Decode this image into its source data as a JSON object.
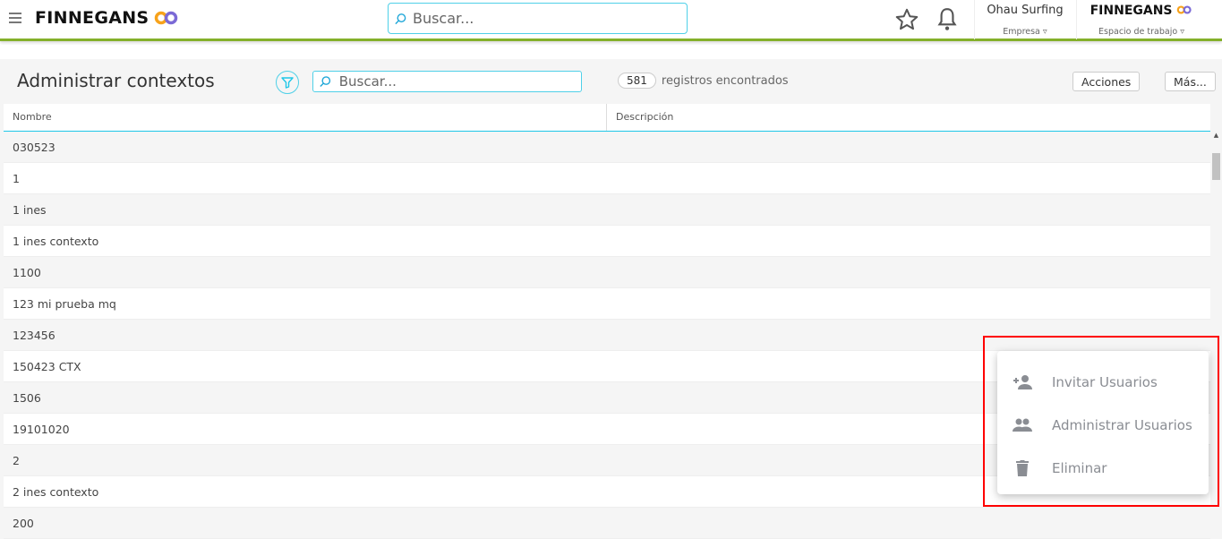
{
  "topbar": {
    "brand": "FINNEGANS",
    "search_placeholder": "Buscar...",
    "company": "Ohau Surfing",
    "company_label": "Empresa",
    "workspace": "FINNEGANS",
    "workspace_label": "Espacio de trabajo"
  },
  "page": {
    "title": "Administrar contextos",
    "search_placeholder": "Buscar...",
    "count": "581",
    "count_label": "registros encontrados",
    "actions_label": "Acciones",
    "more_label": "Más..."
  },
  "table": {
    "columns": [
      "Nombre",
      "Descripción"
    ],
    "rows": [
      "030523",
      "1",
      "1 ines",
      "1 ines contexto",
      "1100",
      "123 mi prueba mq",
      "123456",
      "150423 CTX",
      "1506",
      "19101020",
      "2",
      "2 ines contexto",
      "200"
    ]
  },
  "menu": {
    "items": [
      {
        "label": "Invitar Usuarios",
        "icon": "person-add-icon"
      },
      {
        "label": "Administrar Usuarios",
        "icon": "people-icon"
      },
      {
        "label": "Eliminar",
        "icon": "trash-icon"
      }
    ]
  },
  "colors": {
    "accent": "#1fc7e8",
    "topbar_border": "#84b02a",
    "highlight": "#ff0000"
  }
}
